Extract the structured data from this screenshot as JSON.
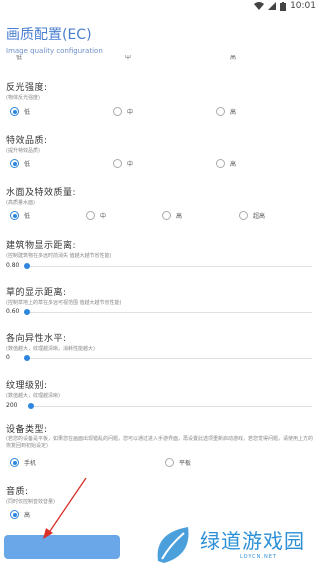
{
  "status": {
    "time": "10:01"
  },
  "header": {
    "title": "画质配置(EC)",
    "subtitle": "Image quality configuration"
  },
  "partial_row": {
    "options": [
      "低",
      "中",
      "高"
    ]
  },
  "sections": {
    "reflection": {
      "title": "反光强度:",
      "desc": "(物体反光强度)",
      "options": [
        "低",
        "中",
        "高"
      ],
      "selected": 0
    },
    "effects": {
      "title": "特效品质:",
      "desc": "(提升特效品质)",
      "options": [
        "低",
        "中",
        "高"
      ],
      "selected": 0
    },
    "water": {
      "title": "水面及特效质量:",
      "desc": "(高质量水面)",
      "options": [
        "低",
        "中",
        "高",
        "超高"
      ],
      "selected": 0
    },
    "buildings": {
      "title": "建筑物显示距离:",
      "desc": "(控制建筑物在多远时前消失 值越大越节省性能)",
      "value": "0.80",
      "fraction": 0.0
    },
    "grass": {
      "title": "草的显示距离:",
      "desc": "(控制草地上的草在多远可视范围 值越大越节省性能)",
      "value": "0.60",
      "fraction": 0.0
    },
    "anisotropy": {
      "title": "各向异性水平:",
      "desc": "(数值越大，纹理越清晰，消耗性能越大)",
      "value": "0",
      "fraction": 0.0
    },
    "texture": {
      "title": "纹理级别:",
      "desc": "(数值越大，纹理越清晰)",
      "value": "200",
      "fraction": 0.0
    },
    "device": {
      "title": "设备类型:",
      "desc": "(若您的设备是平板，如果您在画面出现错乱的问题，您可以通过进入手游界面，再设置此选项重新启动游戏，若您觉得问题，请使用上方的恢复回到初始设定)",
      "options": [
        "手机",
        "平板"
      ],
      "selected": 0
    },
    "audio": {
      "title": "音质:",
      "desc": "(同时仅控制音效音量)",
      "options": [
        "高"
      ],
      "selected": 0
    }
  },
  "watermark": {
    "text": "绿道游戏园",
    "sub": "LDYCN.NET"
  },
  "colors": {
    "accent": "#2e86de",
    "title": "#4a7fd0",
    "button": "#6aa7e8"
  }
}
